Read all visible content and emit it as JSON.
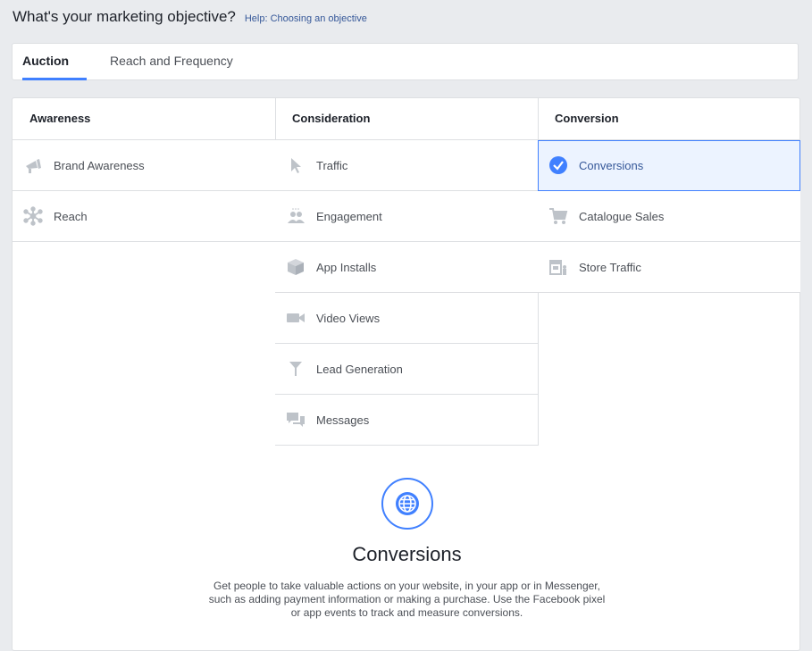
{
  "header": {
    "title": "What's your marketing objective?",
    "help_link": "Help: Choosing an objective"
  },
  "tabs": [
    {
      "label": "Auction",
      "active": true
    },
    {
      "label": "Reach and Frequency",
      "active": false
    }
  ],
  "columns": [
    {
      "title": "Awareness",
      "items": [
        {
          "label": "Brand Awareness",
          "icon": "megaphone-icon"
        },
        {
          "label": "Reach",
          "icon": "reach-network-icon"
        }
      ]
    },
    {
      "title": "Consideration",
      "items": [
        {
          "label": "Traffic",
          "icon": "cursor-icon"
        },
        {
          "label": "Engagement",
          "icon": "people-icon"
        },
        {
          "label": "App Installs",
          "icon": "box-icon"
        },
        {
          "label": "Video Views",
          "icon": "video-camera-icon"
        },
        {
          "label": "Lead Generation",
          "icon": "funnel-icon"
        },
        {
          "label": "Messages",
          "icon": "chat-bubbles-icon"
        }
      ]
    },
    {
      "title": "Conversion",
      "items": [
        {
          "label": "Conversions",
          "icon": "check-circle-icon",
          "selected": true
        },
        {
          "label": "Catalogue Sales",
          "icon": "shopping-cart-icon"
        },
        {
          "label": "Store Traffic",
          "icon": "store-icon"
        }
      ]
    }
  ],
  "detail": {
    "icon": "globe-icon",
    "title": "Conversions",
    "description": "Get people to take valuable actions on your website, in your app or in Messenger, such as adding payment information or making a purchase. Use the Facebook pixel or app events to track and measure conversions."
  },
  "colors": {
    "accent": "#4080ff",
    "icon_gray": "#bec3c9",
    "selected_bg": "#ecf3ff",
    "link": "#365899"
  }
}
